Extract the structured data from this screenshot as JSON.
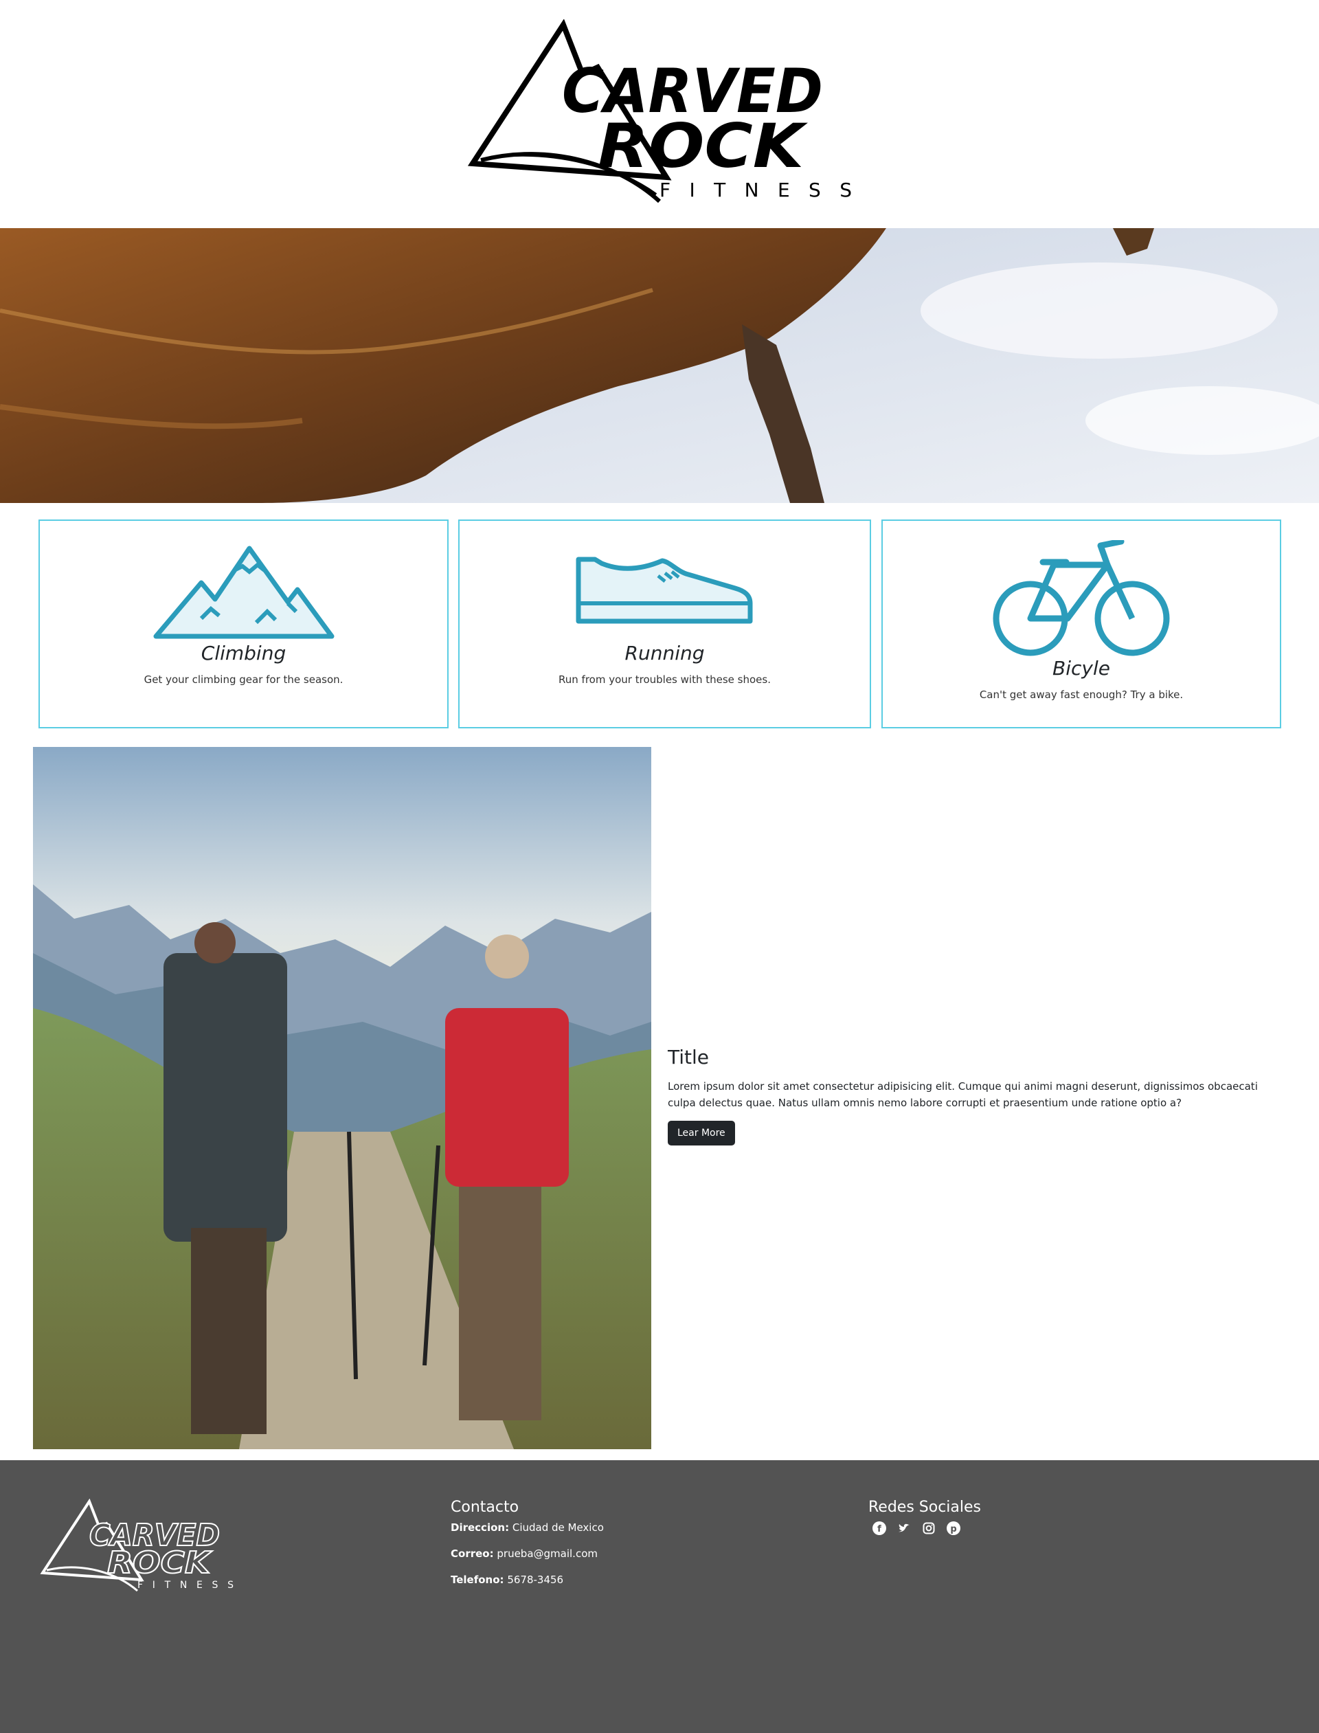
{
  "header": {
    "logo_text_1": "CARVED",
    "logo_text_2": "ROCK",
    "logo_text_3": "FITNESS"
  },
  "cards": [
    {
      "title": "Climbing",
      "text": "Get your climbing gear for the season.",
      "icon": "mountain-icon"
    },
    {
      "title": "Running",
      "text": "Run from your troubles with these shoes.",
      "icon": "shoe-icon"
    },
    {
      "title": "Bicyle",
      "text": "Can't get away fast enough? Try a bike.",
      "icon": "bicycle-icon"
    }
  ],
  "feature": {
    "title": "Title",
    "text": "Lorem ipsum dolor sit amet consectetur adipisicing elit. Cumque qui animi magni deserunt, dignissimos obcaecati culpa delectus quae. Natus ullam omnis nemo labore corrupti et praesentium unde ratione optio a?",
    "button_label": "Lear More"
  },
  "footer": {
    "contact_title": "Contacto",
    "address_label": "Direccion:",
    "address_value": "Ciudad de Mexico",
    "email_label": "Correo:",
    "email_value": "prueba@gmail.com",
    "phone_label": "Telefono:",
    "phone_value": "5678-3456",
    "social_title": "Redes Sociales",
    "social_icons": [
      "facebook-icon",
      "twitter-icon",
      "instagram-icon",
      "pinterest-icon"
    ]
  },
  "colors": {
    "accent": "#2b9cbb",
    "card_border": "#5bcde3",
    "footer_bg": "#535353",
    "button_bg": "#212529"
  }
}
